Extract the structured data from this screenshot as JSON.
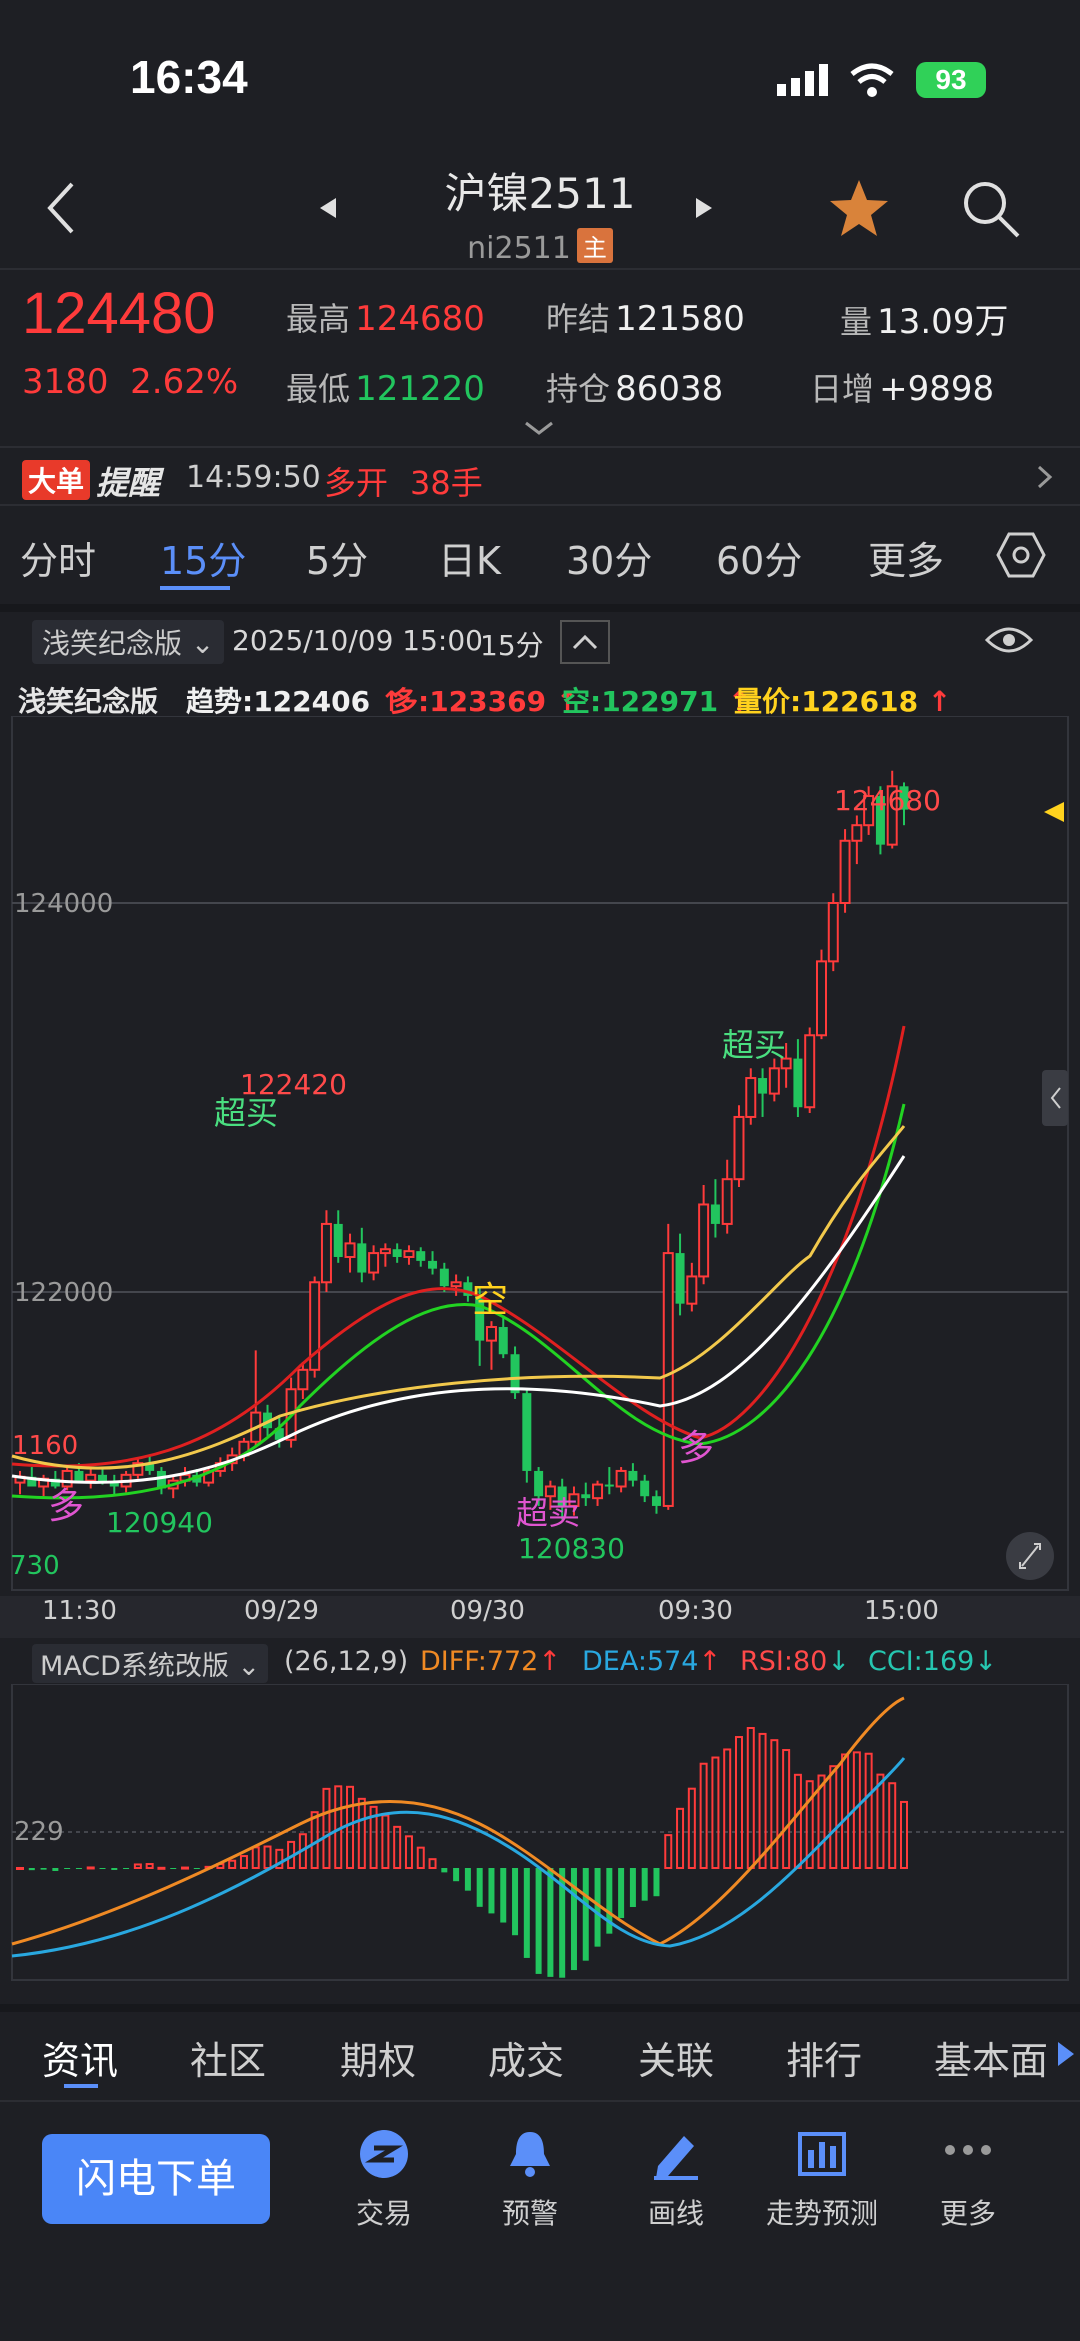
{
  "status": {
    "time": "16:34",
    "battery": "93"
  },
  "header": {
    "title": "沪镍2511",
    "code": "ni2511",
    "badge": "主"
  },
  "quote": {
    "last": "124480",
    "change": "3180",
    "change_pct": "2.62%",
    "high_label": "最高",
    "high": "124680",
    "low_label": "最低",
    "low": "121220",
    "prev_settle_label": "昨结",
    "prev_settle": "121580",
    "open_int_label": "持仓",
    "open_int": "86038",
    "volume_label": "量",
    "volume": "13.09万",
    "daily_add_label": "日增",
    "daily_add": "+9898"
  },
  "alert": {
    "badge": "大单",
    "title": "提醒",
    "time": "14:59:50",
    "action": "多开",
    "qty": "38手"
  },
  "period_tabs": [
    "分时",
    "15分",
    "5分",
    "日K",
    "30分",
    "60分",
    "更多"
  ],
  "active_tab": "15分",
  "chart_header": {
    "indicator_name": "浅笑纪念版",
    "datetime": "2025/10/09 15:00",
    "period": "15分"
  },
  "indicator_line": {
    "name": "浅笑纪念版",
    "trend": "趋势:122406",
    "long": "多:123369",
    "short": "空:122971",
    "vol_price": "量价:122618"
  },
  "chart_data": {
    "type": "candlestick",
    "price_axis_labels": [
      "124000",
      "122000"
    ],
    "x_tick_labels": [
      "11:30",
      "09/29",
      "09/30",
      "09:30",
      "15:00"
    ],
    "annotations": [
      "124680",
      "122420",
      "120940",
      "120830",
      "1160",
      "730",
      "超买",
      "超买",
      "超卖",
      "空",
      "多",
      "多"
    ],
    "candles": [
      [
        121020,
        121080,
        120960,
        121050
      ],
      [
        121050,
        121100,
        121000,
        121000
      ],
      [
        121000,
        121060,
        120950,
        121040
      ],
      [
        121040,
        121080,
        120990,
        121000
      ],
      [
        121000,
        121100,
        120980,
        121080
      ],
      [
        121080,
        121120,
        121020,
        121030
      ],
      [
        121030,
        121090,
        120990,
        121060
      ],
      [
        121060,
        121100,
        121010,
        121020
      ],
      [
        121020,
        121060,
        120950,
        121000
      ],
      [
        121000,
        121080,
        120970,
        121060
      ],
      [
        121060,
        121140,
        121040,
        121120
      ],
      [
        121120,
        121160,
        121060,
        121080
      ],
      [
        121080,
        121100,
        120960,
        120990
      ],
      [
        120990,
        121050,
        120940,
        121030
      ],
      [
        121030,
        121100,
        121000,
        121060
      ],
      [
        121060,
        121090,
        121000,
        121020
      ],
      [
        121020,
        121100,
        121000,
        121080
      ],
      [
        121080,
        121150,
        121050,
        121120
      ],
      [
        121120,
        121200,
        121080,
        121160
      ],
      [
        121160,
        121250,
        121130,
        121230
      ],
      [
        121230,
        121700,
        121200,
        121380
      ],
      [
        121380,
        121420,
        121260,
        121300
      ],
      [
        121300,
        121360,
        121200,
        121240
      ],
      [
        121240,
        121560,
        121200,
        121500
      ],
      [
        121500,
        121640,
        121450,
        121600
      ],
      [
        121600,
        122080,
        121560,
        122050
      ],
      [
        122050,
        122420,
        122000,
        122350
      ],
      [
        122350,
        122420,
        122150,
        122180
      ],
      [
        122180,
        122300,
        122100,
        122250
      ],
      [
        122250,
        122330,
        122050,
        122100
      ],
      [
        122100,
        122240,
        122060,
        122200
      ],
      [
        122200,
        122250,
        122130,
        122220
      ],
      [
        122220,
        122250,
        122150,
        122180
      ],
      [
        122180,
        122240,
        122140,
        122210
      ],
      [
        122210,
        122230,
        122130,
        122160
      ],
      [
        122160,
        122210,
        122090,
        122120
      ],
      [
        122120,
        122150,
        122000,
        122030
      ],
      [
        122030,
        122090,
        121980,
        122050
      ],
      [
        122050,
        122080,
        121950,
        121980
      ],
      [
        121980,
        122020,
        121620,
        121750
      ],
      [
        121750,
        121850,
        121600,
        121820
      ],
      [
        121820,
        121880,
        121660,
        121680
      ],
      [
        121680,
        121720,
        121450,
        121480
      ],
      [
        121480,
        121500,
        121020,
        121080
      ],
      [
        121080,
        121100,
        120900,
        120950
      ],
      [
        120950,
        121030,
        120880,
        121000
      ],
      [
        121000,
        121040,
        120830,
        120900
      ],
      [
        120900,
        121000,
        120850,
        120960
      ],
      [
        120960,
        121020,
        120900,
        120940
      ],
      [
        120940,
        121030,
        120900,
        121010
      ],
      [
        121010,
        121100,
        120960,
        121000
      ],
      [
        121000,
        121100,
        120970,
        121080
      ],
      [
        121080,
        121120,
        121000,
        121030
      ],
      [
        121030,
        121060,
        120920,
        120950
      ],
      [
        120950,
        120980,
        120860,
        120900
      ],
      [
        120900,
        122350,
        120880,
        122200
      ],
      [
        122200,
        122300,
        121880,
        121940
      ],
      [
        121940,
        122150,
        121900,
        122080
      ],
      [
        122080,
        122550,
        122040,
        122450
      ],
      [
        122450,
        122580,
        122280,
        122350
      ],
      [
        122350,
        122680,
        122300,
        122580
      ],
      [
        122580,
        122960,
        122540,
        122900
      ],
      [
        122900,
        123150,
        122860,
        123100
      ],
      [
        123100,
        123150,
        122900,
        123020
      ],
      [
        123020,
        123200,
        122980,
        123150
      ],
      [
        123150,
        123280,
        123050,
        123200
      ],
      [
        123200,
        123300,
        122900,
        122950
      ],
      [
        122950,
        123360,
        122920,
        123320
      ],
      [
        123320,
        123760,
        123300,
        123700
      ],
      [
        123700,
        124050,
        123650,
        124000
      ],
      [
        124000,
        124380,
        123950,
        124320
      ],
      [
        124320,
        124450,
        124200,
        124400
      ],
      [
        124400,
        124600,
        124350,
        124550
      ],
      [
        124550,
        124600,
        124250,
        124300
      ],
      [
        124300,
        124680,
        124280,
        124600
      ],
      [
        124600,
        124620,
        124400,
        124480
      ]
    ]
  },
  "macd_header": {
    "name": "MACD系统改版",
    "params": "(26,12,9)",
    "diff": "DIFF:772",
    "dea": "DEA:574",
    "rsi": "RSI:80",
    "cci": "CCI:169",
    "level": "229"
  },
  "bottom_tabs": [
    "资讯",
    "社区",
    "期权",
    "成交",
    "关联",
    "排行",
    "基本面"
  ],
  "dock": {
    "flash": "闪电下单",
    "items": [
      "交易",
      "预警",
      "画线",
      "走势预测",
      "更多"
    ]
  },
  "colors": {
    "up": "#ff3b3b",
    "down": "#22c55e",
    "accent": "#4a86f7",
    "yellow": "#ffd21e"
  }
}
